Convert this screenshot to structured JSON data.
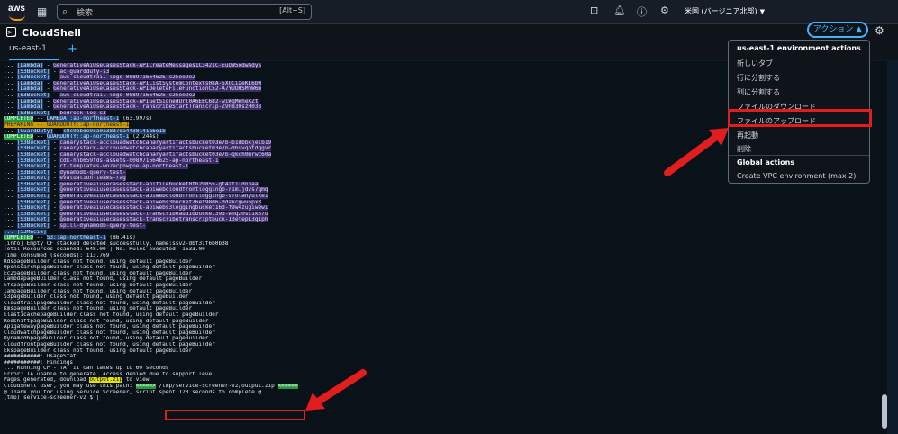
{
  "topbar": {
    "logo": "aws",
    "search_placeholder": "検索",
    "search_shortcut": "[Alt+S]",
    "region": "米国 (バージニア北部)"
  },
  "header": {
    "title": "CloudShell",
    "actions_label": "アクション ▲"
  },
  "tabs": [
    {
      "label": "us-east-1"
    }
  ],
  "menu": {
    "section1_title": "us-east-1 environment actions",
    "items": [
      "新しいタブ",
      "行に分割する",
      "列に分割する",
      "ファイルのダウンロード",
      "ファイルのアップロード",
      "再起動",
      "削除"
    ],
    "section2_title": "Global actions",
    "global_items": [
      "Create VPC environment (max 2)"
    ]
  },
  "terminal": {
    "lines": [
      {
        "t": "... [Lambda] - GenerativeAiUseCasesStack-APICreateMessages1C3421C-EuQW5odwAdyS",
        "k": "hl"
      },
      {
        "t": "... [S3Bucket] - ac-guardduty-s3",
        "k": "hl"
      },
      {
        "t": "... [S3Bucket] - aws-cloudtrail-logs-00897166462S-c25ee2e2",
        "k": "hl"
      },
      {
        "t": "... [Lambda] - GenerativeAiUseCasesStack-APIListSystemContexts08A-5XCCiXeK16bW",
        "k": "hl"
      },
      {
        "t": "... [Lambda] - GenerativeAiUseCasesStack-APIDeleteFileFunctionC52-A7YUUHSMhW6m",
        "k": "hl"
      },
      {
        "t": "... [S3Bucket] - aws-cloudtrail-logs-008971664625-c25ee2e2",
        "k": "hl"
      },
      {
        "t": "... [Lambda] - GenerativeAiUseCasesStack-APIGetSignedUrl0A6EEC682-wiWqMeheXZt",
        "k": "hl"
      },
      {
        "t": "... [Lambda] - GenerativeAiUseCasesStack-TranscribeStartTranscrip-ZVH830szH038",
        "k": "hl"
      },
      {
        "t": "... [S3Bucket] - bedrock-log-s3",
        "k": "hl"
      },
      {
        "t": "COMPLETED -- LAMBDA::ap-northeast-1 (63.997s)",
        "k": "completed"
      },
      {
        "t": "PREPARING -- GUARDDUTY::ap-northeast-1",
        "k": "preparing"
      },
      {
        "t": "... [GuardDuty] - c8c9bbde9ea0a38d7da4438141a6e1b",
        "k": "hl-b"
      },
      {
        "t": "COMPLETED -- GUARDDUTY::ap-northeast-1 (2.244s)",
        "k": "completed"
      },
      {
        "t": "... [S3Bucket] - canarystack-acclouadwatchcanaryartifactsbucket03e7b-b1dbbxjelb19",
        "k": "hl"
      },
      {
        "t": "... [S3Bucket] - canarystack-acclouadwatchcanaryartifactsbucket03e7b-dbsvqbtdqgvr",
        "k": "hl"
      },
      {
        "t": "... [S3Bucket] - canarystack-acclouadwatchcanaryartifactsbucket03e7b-qkch0mrwc60a",
        "k": "hl"
      },
      {
        "t": "... [S3Bucket] - cdk-hnb659fds-assets-008971664625-ap-northeast-1",
        "k": "hl"
      },
      {
        "t": "... [S3Bucket] - cf-templates-wo2ecpnwpoe-ap-northeast-1",
        "k": "hl"
      },
      {
        "t": "... [S3Bucket] - dynamodb-query-test-",
        "k": "hl"
      },
      {
        "t": "... [S3Bucket] - evaluation-teams-rag",
        "k": "hl"
      },
      {
        "t": "... [S3Bucket] - generativeaiusecasesstack-apifilebucket0fb29855-gt4zf1ldnbaa",
        "k": "hl"
      },
      {
        "t": "... [S3Bucket] - generativeaiusecasesstack-apiwebcloudfrontloggingb-r1m1jdvs7qmq",
        "k": "hl"
      },
      {
        "t": "... [S3Bucket] - generativeaiusecasesstack-apiwebcloudfrontloggingb-sfotahyulke1",
        "k": "hl"
      },
      {
        "t": "... [S3Bucket] - generativeaiusecasesstack-apiwebs3bucket26ef98d6-ddakcgwv6px3",
        "k": "hl"
      },
      {
        "t": "... [S3Bucket] - generativeaiusecasesstack-apiwebs3loggingbucket16d-f9w4zugiwewi",
        "k": "hl"
      },
      {
        "t": "... [S3Bucket] - generativeaiusecasesstack-transcribeaudiobucket39d-whqz0sl1k57u",
        "k": "hl"
      },
      {
        "t": "... [S3Bucket] - generativeaiusecasesstack-transcribetranscriptbuck-13etep13g1ph",
        "k": "hl"
      },
      {
        "t": "... [S3Bucket] - spill-dynamodb-query-test-",
        "k": "hl"
      },
      {
        "t": "... [S3Macie]",
        "k": "hl"
      },
      {
        "t": "COMPLETED -- S3::ap-northeast-1 (86.41s)",
        "k": "completed"
      },
      {
        "t": "[info] Empty CF stacked deleted successfully, name:ssv2-dbf31f6b0b38",
        "k": ""
      },
      {
        "t": "Total Resources scanned: 648.00 | No. Rules executed: 1633.00",
        "k": ""
      },
      {
        "t": "Time consumed (seconds): 113.769",
        "k": ""
      },
      {
        "t": "RdspageBuilder class not found, using default pageBuilder",
        "k": ""
      },
      {
        "t": "OpensearchpageBuilder class not found, using default pageBuilder",
        "k": ""
      },
      {
        "t": "Ec2pageBuilder class not found, using default pageBuilder",
        "k": ""
      },
      {
        "t": "LambdapageBuilder class not found, using default pageBuilder",
        "k": ""
      },
      {
        "t": "EfspageBuilder class not found, using default pageBuilder",
        "k": ""
      },
      {
        "t": "IampageBuilder class not found, using default pageBuilder",
        "k": ""
      },
      {
        "t": "S3pageBuilder class not found, using default pageBuilder",
        "k": ""
      },
      {
        "t": "CloudtrailpageBuilder class not found, using default pageBuilder",
        "k": ""
      },
      {
        "t": "KmspageBuilder class not found, using default pageBuilder",
        "k": ""
      },
      {
        "t": "ElasticachepageBuilder class not found, using default pageBuilder",
        "k": ""
      },
      {
        "t": "RedshiftpageBuilder class not found, using default pageBuilder",
        "k": ""
      },
      {
        "t": "ApigatewaypageBuilder class not found, using default pageBuilder",
        "k": ""
      },
      {
        "t": "CloudwatchpageBuilder class not found, using default pageBuilder",
        "k": ""
      },
      {
        "t": "DynamodbpageBuilder class not found, using default pageBuilder",
        "k": ""
      },
      {
        "t": "CloudfrontpageBuilder class not found, using default pageBuilder",
        "k": ""
      },
      {
        "t": "EkspageBuilder class not found, using default pageBuilder",
        "k": ""
      },
      {
        "t": "###########: UsageStat",
        "k": ""
      },
      {
        "t": "###########: Findings",
        "k": ""
      },
      {
        "t": "... Running CP - TA, it can takes up to 60 seconds",
        "k": ""
      },
      {
        "t": "Error: TA unable to generate. Access denied due to support level",
        "k": ""
      },
      {
        "t": "Pages generated, download output.zip to view",
        "k": "pages"
      },
      {
        "t": "CloudShell user, you may use this path: =====> /tmp/service-screener-v2/output.zip <=====",
        "k": "path"
      },
      {
        "t": "@ Thank you for using Service Screener, script spent 120 seconds to complete @",
        "k": ""
      },
      {
        "t": "(tmp) service-screener-v2 $ |",
        "k": ""
      }
    ]
  }
}
